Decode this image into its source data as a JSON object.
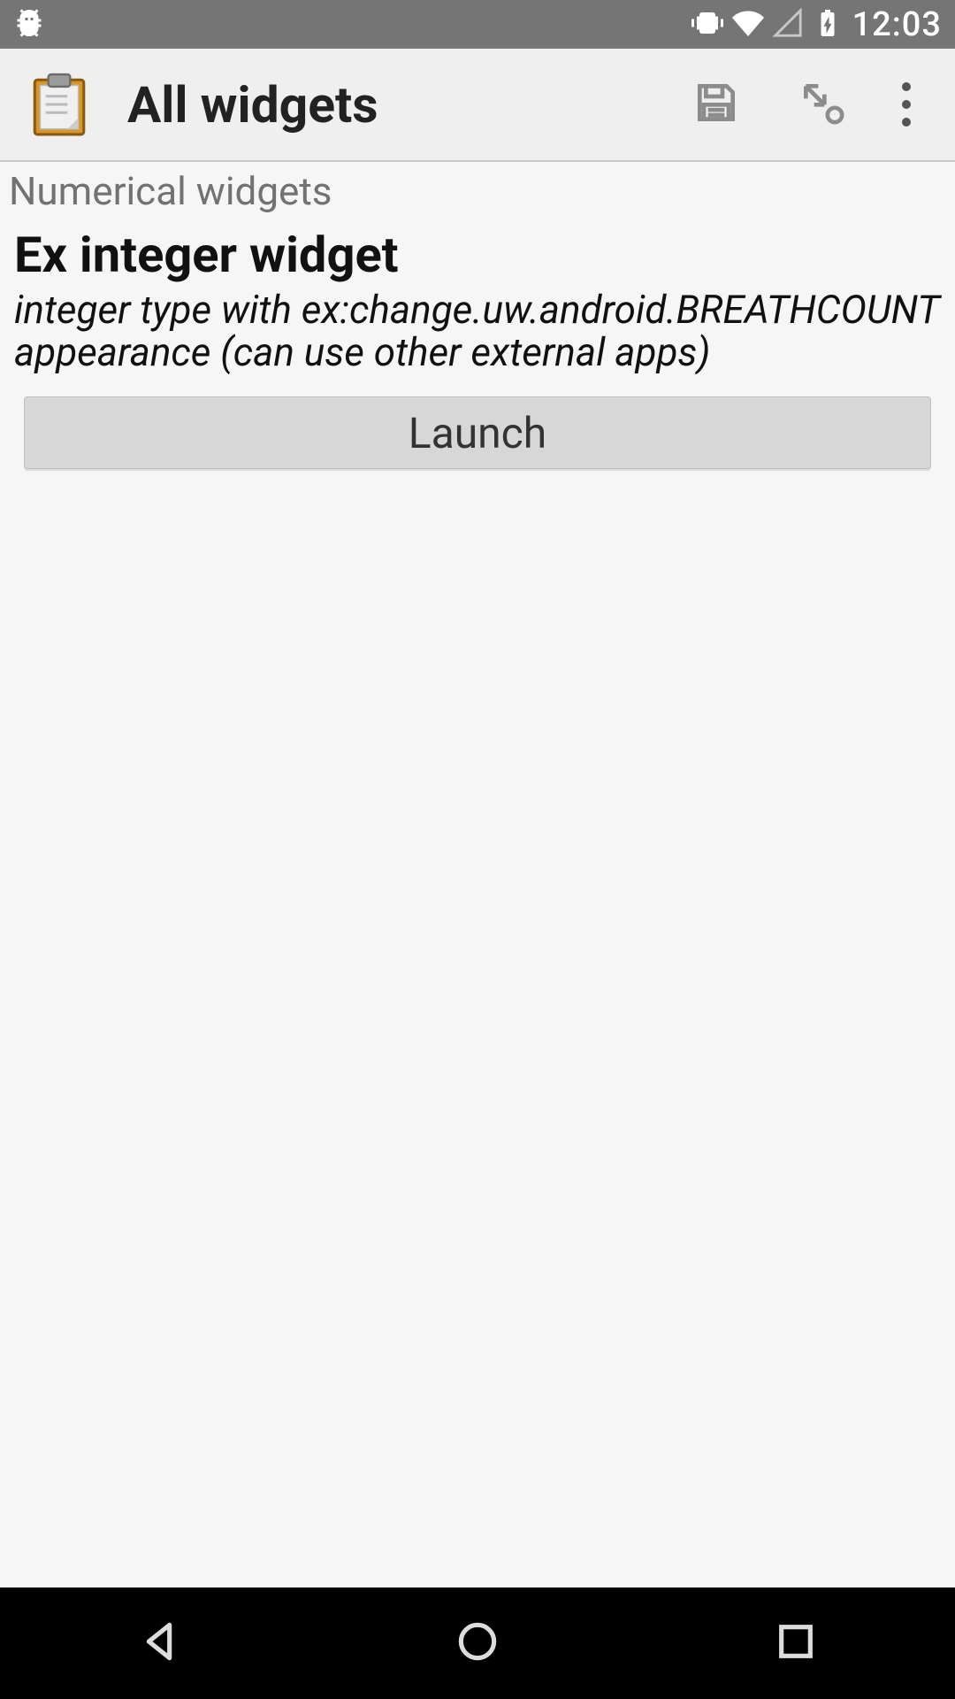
{
  "status": {
    "time": "12:03"
  },
  "toolbar": {
    "title": "All widgets"
  },
  "content": {
    "section_header": "Numerical widgets",
    "widget_title": "Ex integer widget",
    "widget_subtitle": "integer type with ex:change.uw.android.BREATHCOUNT appearance (can use other external apps)",
    "launch_label": "Launch"
  },
  "icons": {
    "debug": "android-debug-icon",
    "vibrate": "vibrate-icon",
    "wifi": "wifi-icon",
    "cell": "cell-signal-icon",
    "battery": "battery-charging-icon",
    "app": "clipboard-icon",
    "save": "save-icon",
    "jump": "jump-icon",
    "more": "more-vert-icon",
    "back": "nav-back-icon",
    "home": "nav-home-icon",
    "recents": "nav-recents-icon"
  }
}
